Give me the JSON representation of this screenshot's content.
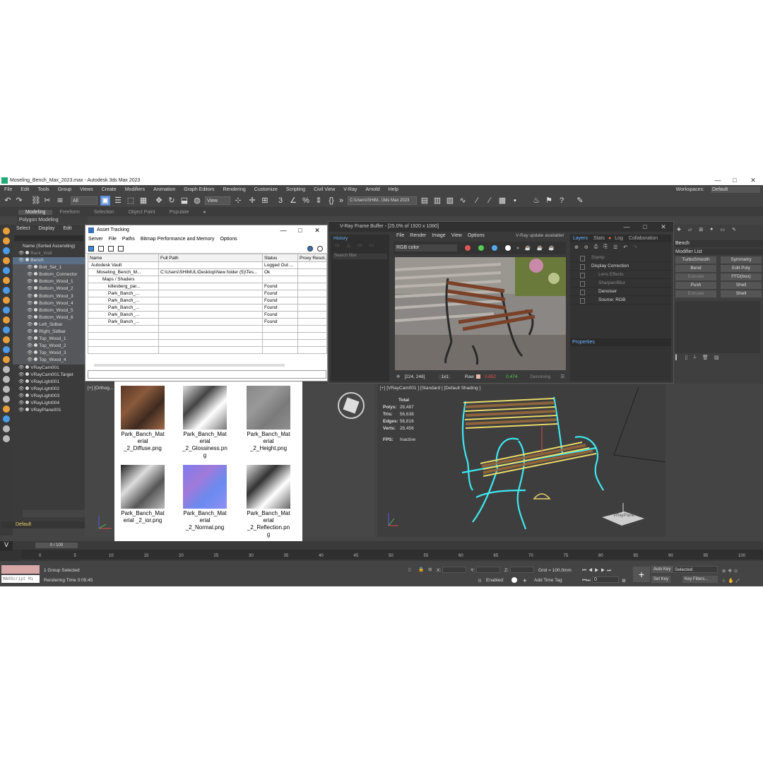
{
  "window": {
    "title": "Moseling_Bench_Max_2023.max - Autodesk 3ds Max 2023",
    "min": "—",
    "max": "□",
    "close": "✕"
  },
  "menu": [
    "File",
    "Edit",
    "Tools",
    "Group",
    "Views",
    "Create",
    "Modifiers",
    "Animation",
    "Graph Editors",
    "Rendering",
    "Customize",
    "Scripting",
    "Civil View",
    "V-Ray",
    "Arnold",
    "Help"
  ],
  "workspaces": {
    "label": "Workspaces:",
    "value": "Default"
  },
  "toolbar": {
    "filter": "All",
    "view": "View",
    "path": "C:\\Users\\SHIM...\\3ds Max 2023"
  },
  "ribbon": {
    "tabs": [
      "Modeling",
      "Freeform",
      "Selection",
      "Object Paint",
      "Populate"
    ],
    "sub": "Polygon Modeling"
  },
  "scene_explorer": {
    "tabs": [
      "Select",
      "Display",
      "Edit"
    ],
    "header": "Name (Sorted Ascending)",
    "items": [
      {
        "name": "Back_Wall",
        "indent": 1
      },
      {
        "name": "Bench",
        "indent": 1
      },
      {
        "name": "Bolt_Set_1",
        "indent": 3
      },
      {
        "name": "Bottom_Connector",
        "indent": 3
      },
      {
        "name": "Bottom_Wood_1",
        "indent": 3
      },
      {
        "name": "Bottom_Wood_2",
        "indent": 3
      },
      {
        "name": "Bottom_Wood_3",
        "indent": 3
      },
      {
        "name": "Bottom_Wood_4",
        "indent": 3
      },
      {
        "name": "Bottom_Wood_5",
        "indent": 3
      },
      {
        "name": "Bottom_Wood_6",
        "indent": 3
      },
      {
        "name": "Left_Sidbar",
        "indent": 3
      },
      {
        "name": "Right_Sidbar",
        "indent": 3
      },
      {
        "name": "Top_Wood_1",
        "indent": 3
      },
      {
        "name": "Top_Wood_2",
        "indent": 3
      },
      {
        "name": "Top_Wood_3",
        "indent": 3
      },
      {
        "name": "Top_Wood_4",
        "indent": 3
      },
      {
        "name": "VRayCam001",
        "indent": 1
      },
      {
        "name": "VRayCam001.Target",
        "indent": 1
      },
      {
        "name": "VRayLight001",
        "indent": 1
      },
      {
        "name": "VRayLight002",
        "indent": 1
      },
      {
        "name": "VRayLight003",
        "indent": 1
      },
      {
        "name": "VRayLight004",
        "indent": 1
      },
      {
        "name": "VRayPlane001",
        "indent": 1
      }
    ],
    "layer": "Default"
  },
  "asset_tracking": {
    "title": "Asset Tracking",
    "menu": [
      "Server",
      "File",
      "Paths",
      "Bitmap Performance and Memory",
      "Options"
    ],
    "columns": [
      "Name",
      "Full Path",
      "Status",
      "Proxy Resol..."
    ],
    "rows": [
      [
        "Autodesk Vault",
        "",
        "Logged Out ...",
        ""
      ],
      [
        "Moseling_Bench_M...",
        "C:\\Users\\SHIMUL\\Desktop\\New folder (5)\\Tes...",
        "Ok",
        ""
      ],
      [
        "Maps / Shaders",
        "",
        "",
        ""
      ],
      [
        "killesberg_par...",
        "",
        "Found",
        ""
      ],
      [
        "Park_Banch_...",
        "",
        "Found",
        ""
      ],
      [
        "Park_Banch_...",
        "",
        "Found",
        ""
      ],
      [
        "Park_Banch_...",
        "",
        "Found",
        ""
      ],
      [
        "Park_Banch_...",
        "",
        "Found",
        ""
      ],
      [
        "Park_Banch_...",
        "",
        "Found",
        ""
      ]
    ]
  },
  "vfb": {
    "title": "V-Ray Frame Buffer - [25.0% of 1920 x 1080]",
    "history_label": "History",
    "filter_placeholder": "Search filter",
    "menu": [
      "File",
      "Render",
      "Image",
      "View",
      "Options"
    ],
    "update": "V-Ray update available!",
    "channel": "RGB color",
    "coords": "[224, 248]",
    "zoom": "1x1",
    "raw_label": "Raw",
    "raw_r": "0.652",
    "raw_g": "0.474",
    "denoising": "Denoising",
    "tabs": [
      "Layers",
      "Stats",
      "Log",
      "Collaboration"
    ],
    "layers": [
      {
        "name": "Stamp",
        "dim": true
      },
      {
        "name": "Display Correction",
        "dim": false
      },
      {
        "name": "Lens Effects",
        "dim": true
      },
      {
        "name": "Sharpen/Blur",
        "dim": true
      },
      {
        "name": "Denoiser",
        "dim": false
      },
      {
        "name": "Source: RGB",
        "dim": false
      }
    ],
    "properties": "Properties"
  },
  "command_panel": {
    "name": "Bench",
    "modifier_list": "Modifier List",
    "buttons": [
      {
        "label": "TurboSmooth",
        "dim": false
      },
      {
        "label": "Symmetry",
        "dim": false
      },
      {
        "label": "Bend",
        "dim": false
      },
      {
        "label": "Edit Poly",
        "dim": false
      },
      {
        "label": "Extrude",
        "dim": true
      },
      {
        "label": "FFD(box)",
        "dim": false
      },
      {
        "label": "Push",
        "dim": false
      },
      {
        "label": "Shell",
        "dim": false
      },
      {
        "label": "Extrude",
        "dim": true
      },
      {
        "label": "Shell",
        "dim": false
      }
    ]
  },
  "viewport_left": {
    "label": "[+] [Orthog..."
  },
  "textures": [
    {
      "name": "Park_Banch_Material_2_Diffuse.png",
      "kind": "diffuse"
    },
    {
      "name": "Park_Banch_Material_2_Glossiness.png",
      "kind": "gloss"
    },
    {
      "name": "Park_Banch_Material_2_Height.png",
      "kind": "height"
    },
    {
      "name": "Park_Banch_Material_2_ior.png",
      "kind": "ior"
    },
    {
      "name": "Park_Banch_Material_2_Normal.png",
      "kind": "normal"
    },
    {
      "name": "Park_Banch_Material_2_Reflection.png",
      "kind": "refl"
    }
  ],
  "texture_labels": [
    [
      "Park_Banch_Mat",
      "erial",
      "_2_Diffuse.png"
    ],
    [
      "Park_Banch_Mat",
      "erial",
      "_2_Glossiness.pn",
      "g"
    ],
    [
      "Park_Banch_Mat",
      "erial",
      "_2_Height.png"
    ],
    [
      "Park_Banch_Mat",
      "erial _2_ior.png"
    ],
    [
      "Park_Banch_Mat",
      "erial",
      "_2_Normal.png"
    ],
    [
      "Park_Banch_Mat",
      "erial",
      "_2_Reflection.pn",
      "g"
    ]
  ],
  "viewport_right": {
    "label": "[+] [VRayCam001 ] [Standard ] [Default Shading ]",
    "stats_title": "Total",
    "polys_label": "Polys:",
    "polys": "28,487",
    "tris_label": "Tris:",
    "tris": "56,638",
    "edges_label": "Edges:",
    "edges": "56,816",
    "verts_label": "Verts:",
    "verts": "28,456",
    "fps_label": "FPS:",
    "fps": "Inactive",
    "plane_label": "VRayPlane"
  },
  "timeline": {
    "frame": "0 / 100",
    "ticks": [
      "0",
      "5",
      "10",
      "15",
      "20",
      "25",
      "30",
      "35",
      "40",
      "45",
      "50",
      "55",
      "60",
      "65",
      "70",
      "75",
      "80",
      "85",
      "90",
      "95",
      "100"
    ]
  },
  "status": {
    "selection": "1 Group Selected",
    "render_time": "Rendering Time  0:05:45",
    "maxscript": "MAXScript Mi",
    "x_label": "X:",
    "y_label": "Y:",
    "z_label": "Z:",
    "grid": "Grid = 100.0mm",
    "enabled": "Enabled:",
    "add_time_tag": "Add Time Tag",
    "auto_key": "Auto Key",
    "set_key": "Set Key",
    "selected": "Selected",
    "key_filters": "Key Filters...",
    "frame_value": "0"
  }
}
